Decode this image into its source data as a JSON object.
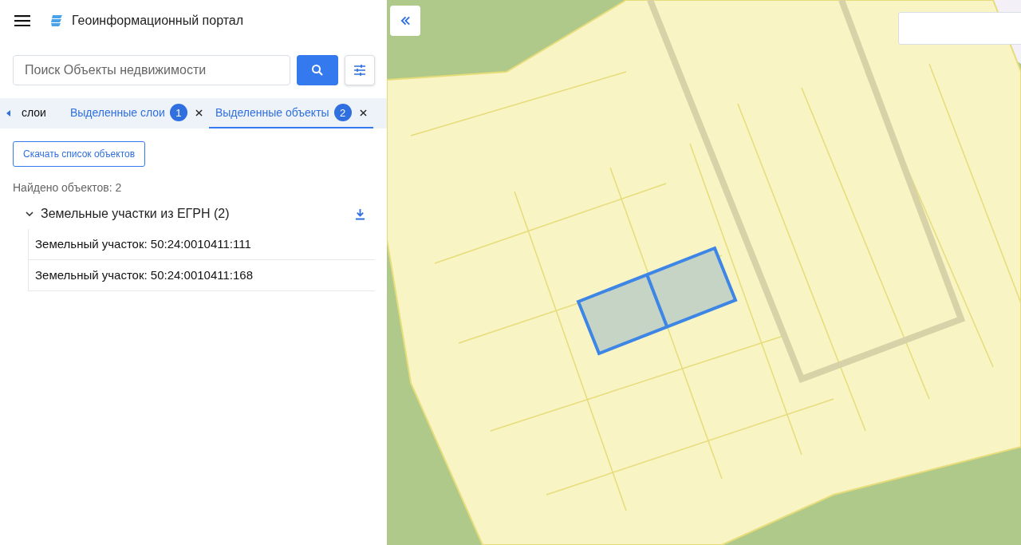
{
  "header": {
    "title": "Геоинформационный портал"
  },
  "search": {
    "placeholder": "Поиск Объекты недвижимости"
  },
  "tabs": [
    {
      "label": "слои",
      "selected": false
    },
    {
      "label": "Выделенные слои",
      "badge": "1",
      "selected": false
    },
    {
      "label": "Выделенные объекты",
      "badge": "2",
      "selected": true
    }
  ],
  "download_button": "Скачать список объектов",
  "found": "Найдено объектов: 2",
  "groups": [
    {
      "label": "Земельные участки из ЕГРН (2)",
      "expanded": true,
      "children": [
        {
          "label": "Земельный участок: 50:24:0010411:111"
        },
        {
          "label": "Земельный участок: 50:24:0010411:168"
        }
      ]
    }
  ]
}
